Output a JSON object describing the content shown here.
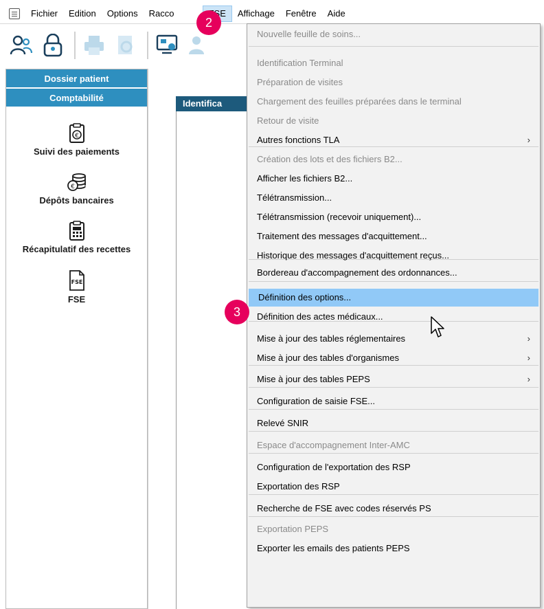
{
  "menubar": {
    "items": [
      "Fichier",
      "Edition",
      "Options",
      "Racco",
      "FSE",
      "Affichage",
      "Fenêtre",
      "Aide"
    ]
  },
  "sidebar": {
    "tabs": [
      "Dossier patient",
      "Comptabilité"
    ],
    "shortcuts": [
      "Suivi des paiements",
      "Dépôts bancaires",
      "Récapitulatif des recettes",
      "FSE"
    ]
  },
  "content": {
    "grid_header": "Identifica"
  },
  "fse_menu": {
    "items": [
      {
        "label": "Nouvelle feuille de soins...",
        "disabled": true
      },
      {
        "label": "Identification Terminal",
        "disabled": true
      },
      {
        "label": "Préparation de visites",
        "disabled": true
      },
      {
        "label": "Chargement des feuilles préparées dans le terminal",
        "disabled": true
      },
      {
        "label": "Retour de visite",
        "disabled": true
      },
      {
        "label": "Autres fonctions TLA",
        "disabled": false,
        "submenu": true
      },
      {
        "label": "Création des lots et des fichiers B2...",
        "disabled": true
      },
      {
        "label": "Afficher les fichiers B2...",
        "disabled": false
      },
      {
        "label": "Télétransmission...",
        "disabled": false
      },
      {
        "label": "Télétransmission (recevoir uniquement)...",
        "disabled": false
      },
      {
        "label": "Traitement des messages d'acquittement...",
        "disabled": false
      },
      {
        "label": "Historique des messages d'acquittement reçus...",
        "disabled": false
      },
      {
        "label": "Bordereau d'accompagnement des ordonnances...",
        "disabled": false
      },
      {
        "label": "Définition des options...",
        "disabled": false,
        "highlighted": true
      },
      {
        "label": "Définition des actes médicaux...",
        "disabled": false
      },
      {
        "label": "Mise à jour des tables réglementaires",
        "disabled": false,
        "submenu": true
      },
      {
        "label": "Mise à jour des tables d'organismes",
        "disabled": false,
        "submenu": true
      },
      {
        "label": "Mise à jour des tables PEPS",
        "disabled": false,
        "submenu": true
      },
      {
        "label": "Configuration de saisie FSE...",
        "disabled": false
      },
      {
        "label": "Relevé SNIR",
        "disabled": false
      },
      {
        "label": "Espace d'accompagnement Inter-AMC",
        "disabled": true
      },
      {
        "label": "Configuration de l'exportation des RSP",
        "disabled": false
      },
      {
        "label": "Exportation des RSP",
        "disabled": false
      },
      {
        "label": "Recherche de FSE avec codes réservés PS",
        "disabled": false
      },
      {
        "label": "Exportation PEPS",
        "disabled": true
      },
      {
        "label": "Exporter les emails des patients PEPS",
        "disabled": false
      }
    ],
    "submenu_arrow": "›"
  },
  "annotations": {
    "step2": "2",
    "step3": "3"
  },
  "colors": {
    "accent": "#2e8fbf",
    "highlight": "#91c9f7",
    "badge": "#e6005c",
    "grid_header": "#1d5a7c"
  }
}
